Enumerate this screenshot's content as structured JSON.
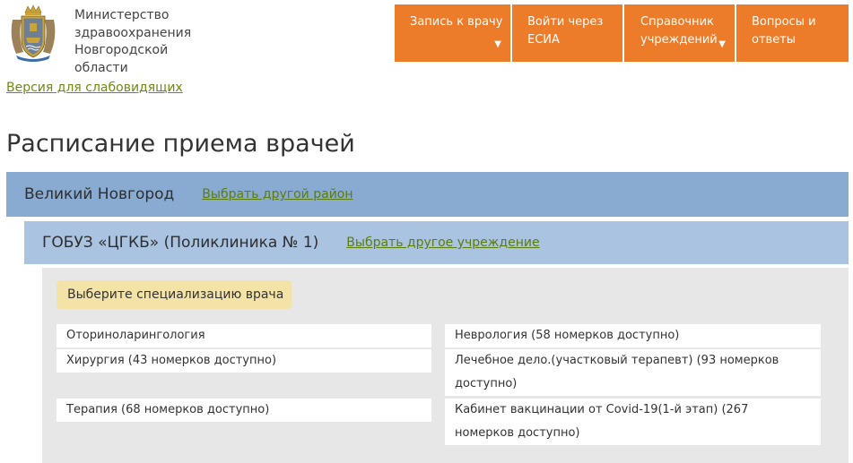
{
  "header": {
    "ministry": "Министерство здравоохранения Новгородской области",
    "vision_link": "Версия для слабовидящих"
  },
  "nav": {
    "items": [
      {
        "label": "Запись к врачу",
        "icon": "caret-down-icon"
      },
      {
        "label": "Войти через ЕСИА"
      },
      {
        "label": "Справочник учреждений",
        "icon": "caret-down-icon"
      },
      {
        "label": "Вопросы и ответы"
      }
    ]
  },
  "page": {
    "title": "Расписание приема врачей"
  },
  "region": {
    "name": "Великий Новгород",
    "change_link": "Выбрать другой район"
  },
  "institution": {
    "name": "ГОБУЗ «ЦГКБ» (Поликлиника № 1)",
    "change_link": "Выбрать другое учреждение"
  },
  "specializations": {
    "prompt": "Выберите специализацию врача",
    "items": [
      "Оториноларингология",
      "Неврология (58 номерков доступно)",
      "Хирургия (43 номерков доступно)",
      "Лечебное дело.(участковый терапевт) (93 номерков доступно)",
      "Терапия (68 номерков доступно)",
      "Кабинет вакцинации от Covid-19(1-й этап) (267 номерков доступно)"
    ]
  },
  "colors": {
    "nav_orange": "#ec7b2a",
    "region_bar": "#8aabd1",
    "institution_bar": "#a9c3e1",
    "link_green": "#5a7d0c",
    "badge_yellow": "#f4e3a6",
    "panel_gray": "#e7e7e7"
  }
}
